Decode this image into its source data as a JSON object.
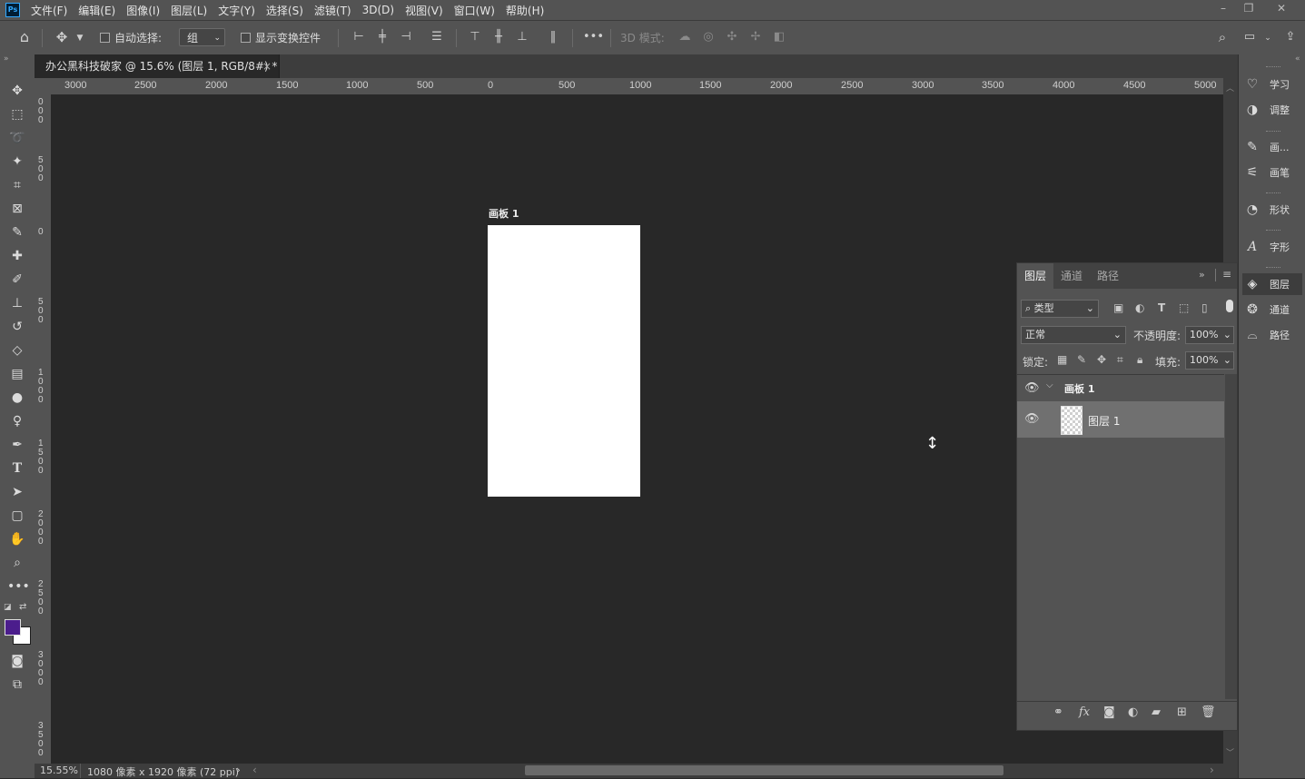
{
  "app": {
    "logo": "Ps"
  },
  "menu": [
    "文件(F)",
    "编辑(E)",
    "图像(I)",
    "图层(L)",
    "文字(Y)",
    "选择(S)",
    "滤镜(T)",
    "3D(D)",
    "视图(V)",
    "窗口(W)",
    "帮助(H)"
  ],
  "window_controls": {
    "minimize": "–",
    "restore": "❐",
    "close": "✕"
  },
  "options": {
    "auto_select_label": "自动选择:",
    "auto_select_value": "组",
    "show_transform_label": "显示变换控件",
    "more": "•••",
    "mode_3d_label": "3D 模式:"
  },
  "document": {
    "tab_title": "办公黑科技破家 @ 15.6% (图层 1, RGB/8#) *",
    "tab_close": "×"
  },
  "ruler_top": [
    "3000",
    "2500",
    "2000",
    "1500",
    "1000",
    "500",
    "0",
    "500",
    "1000",
    "1500",
    "2000",
    "2500",
    "3000",
    "3500",
    "4000",
    "4500",
    "5000"
  ],
  "ruler_left": [
    "0 0 0",
    "5 0 0",
    "0",
    "5 0 0",
    "1 0 0 0",
    "1 5 0 0",
    "2 0 0 0",
    "2 5 0 0",
    "3 0 0 0",
    "3 5 0 0"
  ],
  "artboard": {
    "label": "画板 1"
  },
  "colors": {
    "foreground": "#4b1d8c",
    "background": "#ffffff"
  },
  "status": {
    "zoom": "15.55%",
    "doc_info": "1080 像素 x 1920 像素 (72 ppi)",
    "arrow": "›",
    "scroll_left": "‹",
    "scroll_right": "›"
  },
  "dock": [
    {
      "label": "学习",
      "icon": "lightbulb-icon"
    },
    {
      "label": "调整",
      "icon": "adjust-icon"
    },
    {
      "label": "画...",
      "icon": "brush-presets-icon"
    },
    {
      "label": "画笔",
      "icon": "brush-settings-icon"
    },
    {
      "label": "形状",
      "icon": "shapes-icon"
    },
    {
      "label": "字形",
      "icon": "glyphs-icon"
    },
    {
      "label": "图层",
      "icon": "layers-icon"
    },
    {
      "label": "通道",
      "icon": "channels-icon"
    },
    {
      "label": "路径",
      "icon": "paths-icon"
    }
  ],
  "layers_panel": {
    "tabs": [
      "图层",
      "通道",
      "路径"
    ],
    "filter_label": "类型",
    "blend_mode": "正常",
    "opacity_label": "不透明度:",
    "opacity_value": "100%",
    "lock_label": "锁定:",
    "fill_label": "填充:",
    "fill_value": "100%",
    "layers": [
      {
        "name": "画板 1",
        "type": "artboard"
      },
      {
        "name": "图层 1",
        "type": "layer"
      }
    ]
  }
}
